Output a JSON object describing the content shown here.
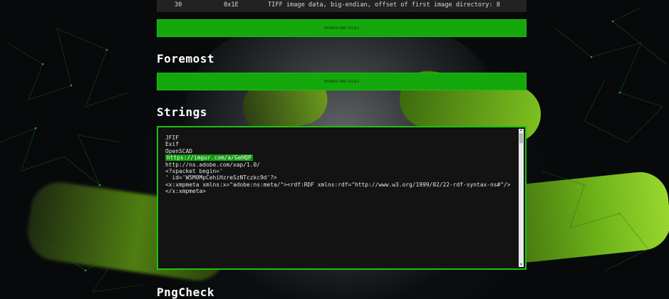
{
  "binwalk_row": {
    "decimal": "30",
    "hex": "0x1E",
    "description": "TIFF image data, big-endian, offset of first image directory: 8"
  },
  "binwalk_download_label": "DOWNLOAD FILES",
  "foremost": {
    "title": "Foremost",
    "download_label": "DOWNLOAD FILES"
  },
  "strings": {
    "title": "Strings",
    "lines": [
      "JFIF",
      "Exif",
      "OpenSCAD",
      "https://imgur.com/a/GeHQP",
      "http://ns.adobe.com/xap/1.0/",
      "<?xpacket begin='",
      "' id='W5M0MpCehiHzreSzNTczkc9d'?>",
      "<x:xmpmeta xmlns:x=\"adobe:ns:meta/\"><rdf:RDF xmlns:rdf=\"http://www.w3.org/1999/02/22-rdf-syntax-ns#\"/></x:xmpmeta>"
    ]
  },
  "pngcheck": {
    "title": "PngCheck"
  },
  "colors": {
    "accent": "#14a80c",
    "highlight": "#0f9a0a",
    "box_bg": "#131313"
  }
}
